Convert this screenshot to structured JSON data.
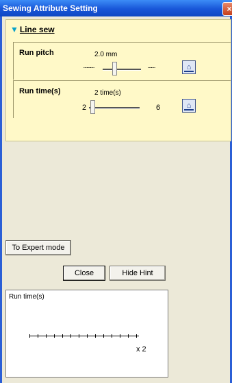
{
  "window": {
    "title": "Sewing Attribute Setting",
    "close_glyph": "×"
  },
  "section": {
    "icon": "▼",
    "title": "Line sew"
  },
  "run_pitch": {
    "label": "Run pitch",
    "value": "2.0 mm",
    "min_glyph": "┈┈┈",
    "max_glyph": "┈┈",
    "slider_fraction": 0.25
  },
  "run_time": {
    "label": "Run time(s)",
    "value": "2 time(s)",
    "min": "2",
    "max": "6",
    "slider_fraction": 0.0
  },
  "buttons": {
    "expert": "To Expert mode",
    "close": "Close",
    "hint": "Hide Hint"
  },
  "hint": {
    "title": "Run time(s)",
    "multiplier": "x 2"
  },
  "colors": {
    "panel": "#fff9c8",
    "titlebar": "#1856d8",
    "dialog": "#ece9d8"
  }
}
